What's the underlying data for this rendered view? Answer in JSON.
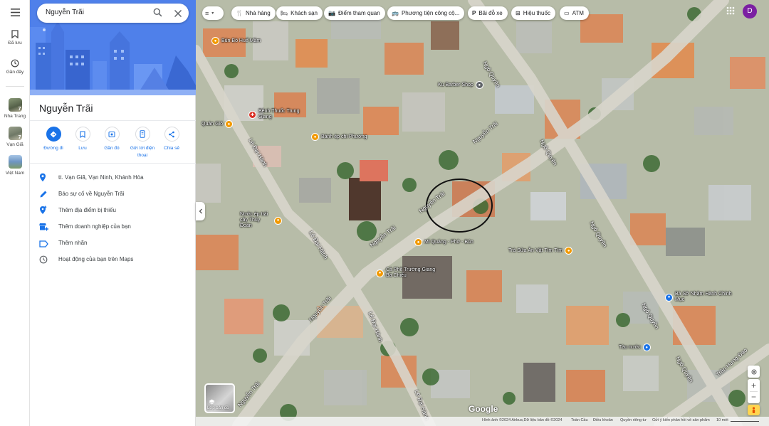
{
  "rail": {
    "saved_label": "Đã lưu",
    "recent_label": "Gần đây",
    "recent_places": [
      {
        "label": "Nha Trang",
        "badge": "7"
      },
      {
        "label": "Vạn Giã",
        "badge": "7"
      },
      {
        "label": "Việt Nam",
        "badge": ""
      }
    ]
  },
  "search": {
    "query": "Nguyễn Trãi"
  },
  "place": {
    "title": "Nguyễn Trãi",
    "actions": [
      "Đường đi",
      "Lưu",
      "Gần đó",
      "Gửi tới điện thoại",
      "Chia sẻ"
    ],
    "details": [
      {
        "icon": "location-pin-icon",
        "text": "tt. Vạn Giã, Vạn Ninh, Khánh Hòa"
      },
      {
        "icon": "pencil-icon",
        "text": "Báo sự cố về Nguyễn Trãi"
      },
      {
        "icon": "add-location-icon",
        "text": "Thêm địa điểm bị thiếu"
      },
      {
        "icon": "add-business-icon",
        "text": "Thêm doanh nghiệp của bạn"
      },
      {
        "icon": "label-icon",
        "text": "Thêm nhãn"
      },
      {
        "icon": "history-icon",
        "text": "Hoạt động của bạn trên Maps"
      }
    ]
  },
  "chips": [
    {
      "icon": "restaurant-icon",
      "label": "Nhà hàng"
    },
    {
      "icon": "hotel-icon",
      "label": "Khách sạn"
    },
    {
      "icon": "camera-icon",
      "label": "Điểm tham quan"
    },
    {
      "icon": "bus-icon",
      "label": "Phương tiện công cộ..."
    },
    {
      "icon": "parking-icon",
      "label": "Bãi đỗ xe"
    },
    {
      "icon": "pharmacy-icon",
      "label": "Hiệu thuốc"
    },
    {
      "icon": "atm-icon",
      "label": "ATM"
    }
  ],
  "map_pins": [
    {
      "name": "Bún Bò Huế Mâm",
      "color": "#f29900"
    },
    {
      "name": "Ku Barber Shop",
      "color": "#5f6368"
    },
    {
      "name": "Bệnh Thuốc Trung Giang",
      "color": "#d93025"
    },
    {
      "name": "Bánh ép chi Phương",
      "color": "#f29900"
    },
    {
      "name": "Nước ép trái cây Thùy Đoàn",
      "color": "#f29900"
    },
    {
      "name": "Mì Quảng - Phở - Bún",
      "color": "#f29900"
    },
    {
      "name": "Trà Sữa Ăn Vặt Tím Tím",
      "color": "#f29900"
    },
    {
      "name": "Cà Phê Trường Giang Ba Chiếu",
      "color": "#f29900"
    },
    {
      "name": "Bà Sở Nhậm Hành Chính Mục",
      "color": "#1a73e8"
    },
    {
      "name": "Tàu nước",
      "color": "#1a73e8"
    },
    {
      "name": "Quán Gió",
      "color": "#f29900"
    }
  ],
  "streets": [
    "Nguyễn Trãi",
    "Nguyễn Trãi",
    "Nguyễn Trãi",
    "Nguyễn Trãi",
    "Ngô Quyền",
    "Ngô Quyền",
    "Ngô Quyền",
    "Ngô Quyền",
    "Ngô Quyền",
    "Lê Đại Hành",
    "Lê Đại Hành",
    "Lê Đại Hành",
    "Lê Đại Hành",
    "Trần Hưng Đạo",
    "Nguyễn Trãi"
  ],
  "avatar_letter": "D",
  "layers_label": "Lớp bản đồ",
  "google_logo": "Google",
  "footer": {
    "imagery": "Hình ảnh ©2024 Airbus,Dữ liệu bản đồ ©2024",
    "links": [
      "Toàn Cầu",
      "Điều khoản",
      "Quyền riêng tư",
      "Gửi ý kiến phản hồi về sản phẩm"
    ],
    "scale": "10 mét"
  },
  "colors": {
    "accent": "#1a73e8",
    "avatar": "#7b1fa2"
  }
}
